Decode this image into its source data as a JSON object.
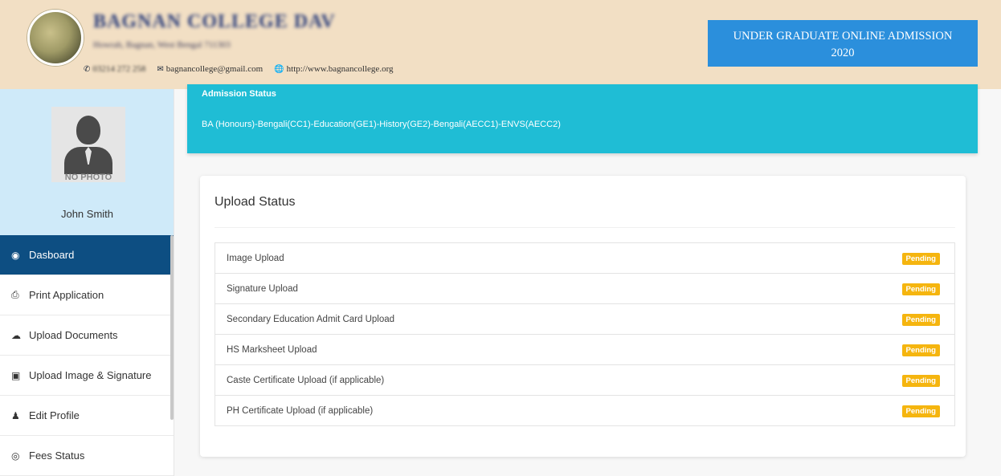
{
  "header": {
    "college_name": "BAGNAN COLLEGE DAV",
    "college_address": "Howrah, Bagnan, West Bengal 711303",
    "phone": "03214 272 258",
    "email": "bagnancollege@gmail.com",
    "website": "http://www.bagnancollege.org",
    "admission_banner_line1": "UNDER GRADUATE ONLINE ADMISSION",
    "admission_banner_line2": "2020"
  },
  "profile": {
    "photo_label": "NO PHOTO",
    "username": "John Smith"
  },
  "sidebar": {
    "items": [
      {
        "label": "Dasboard",
        "icon": "dashboard-icon",
        "active": true
      },
      {
        "label": "Print Application",
        "icon": "print-icon"
      },
      {
        "label": "Upload Documents",
        "icon": "cloud-upload-icon"
      },
      {
        "label": "Upload Image & Signature",
        "icon": "image-icon"
      },
      {
        "label": "Edit Profile",
        "icon": "user-icon"
      },
      {
        "label": "Fees Status",
        "icon": "eye-icon"
      }
    ]
  },
  "admission_status": {
    "title": "Admission Status",
    "course": "BA (Honours)-Bengali(CC1)-Education(GE1)-History(GE2)-Bengali(AECC1)-ENVS(AECC2)"
  },
  "upload_status": {
    "title": "Upload Status",
    "rows": [
      {
        "label": "Image Upload",
        "status": "Pending"
      },
      {
        "label": "Signature Upload",
        "status": "Pending"
      },
      {
        "label": "Secondary Education Admit Card Upload",
        "status": "Pending"
      },
      {
        "label": "HS Marksheet Upload",
        "status": "Pending"
      },
      {
        "label": "Caste Certificate Upload (if applicable)",
        "status": "Pending"
      },
      {
        "label": "PH Certificate Upload (if applicable)",
        "status": "Pending"
      }
    ]
  },
  "colors": {
    "header_bg": "#f2dfc4",
    "banner_blue": "#2b8fdc",
    "sidebar_active": "#0d4e82",
    "admission_cyan": "#1fbdd5",
    "pending_badge": "#f5b50f"
  }
}
